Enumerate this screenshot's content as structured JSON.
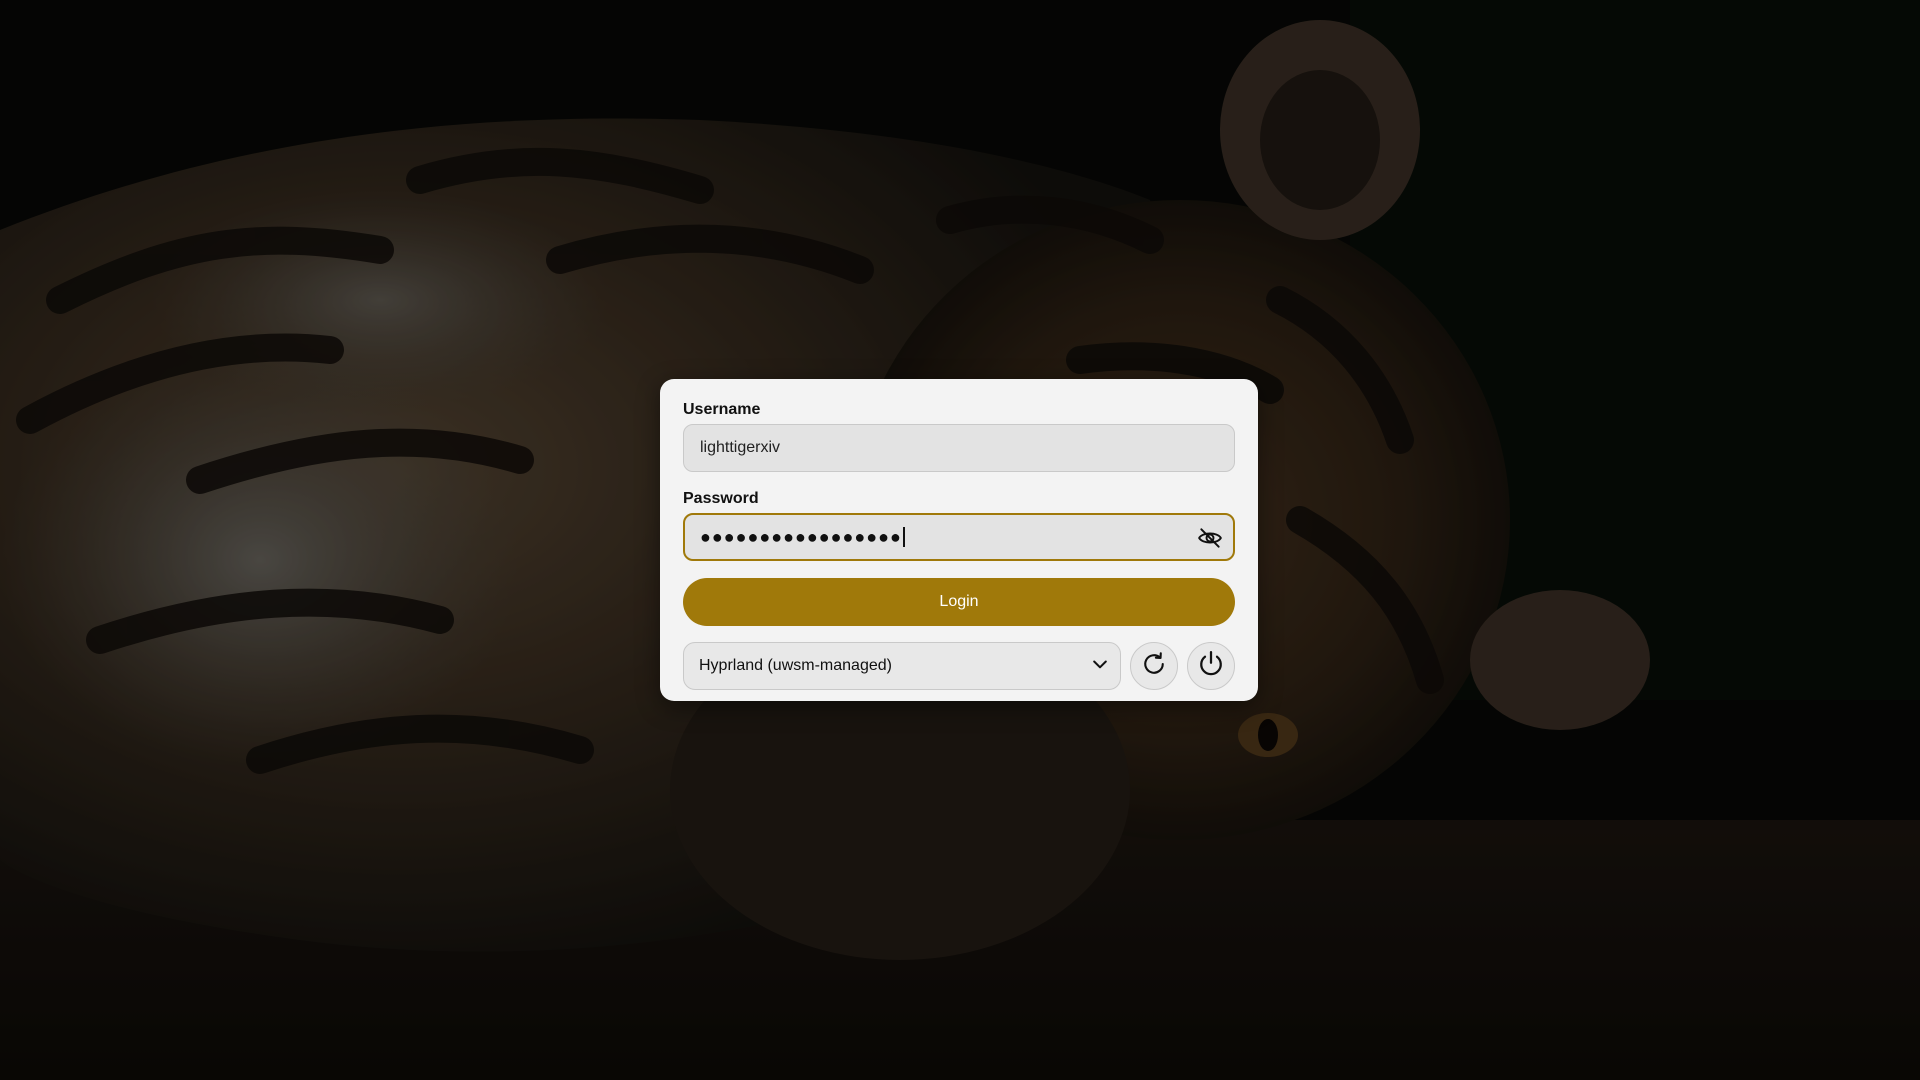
{
  "login_form": {
    "username_label": "Username",
    "username_value": "lighttigerxiv",
    "password_label": "Password",
    "password_masked": "●●●●●●●●●●●●●●●●●",
    "toggle_visibility_icon": "eye-off-icon",
    "login_label": "Login",
    "session_value": "Hyprland (uwsm-managed)",
    "reboot_icon": "reboot-icon",
    "poweroff_icon": "power-icon"
  },
  "theme": {
    "accent": "#a0790a",
    "card_background": "#f3f3f3",
    "field_background": "#e3e3e3"
  },
  "wallpaper": "tiger-lying-down-photo"
}
